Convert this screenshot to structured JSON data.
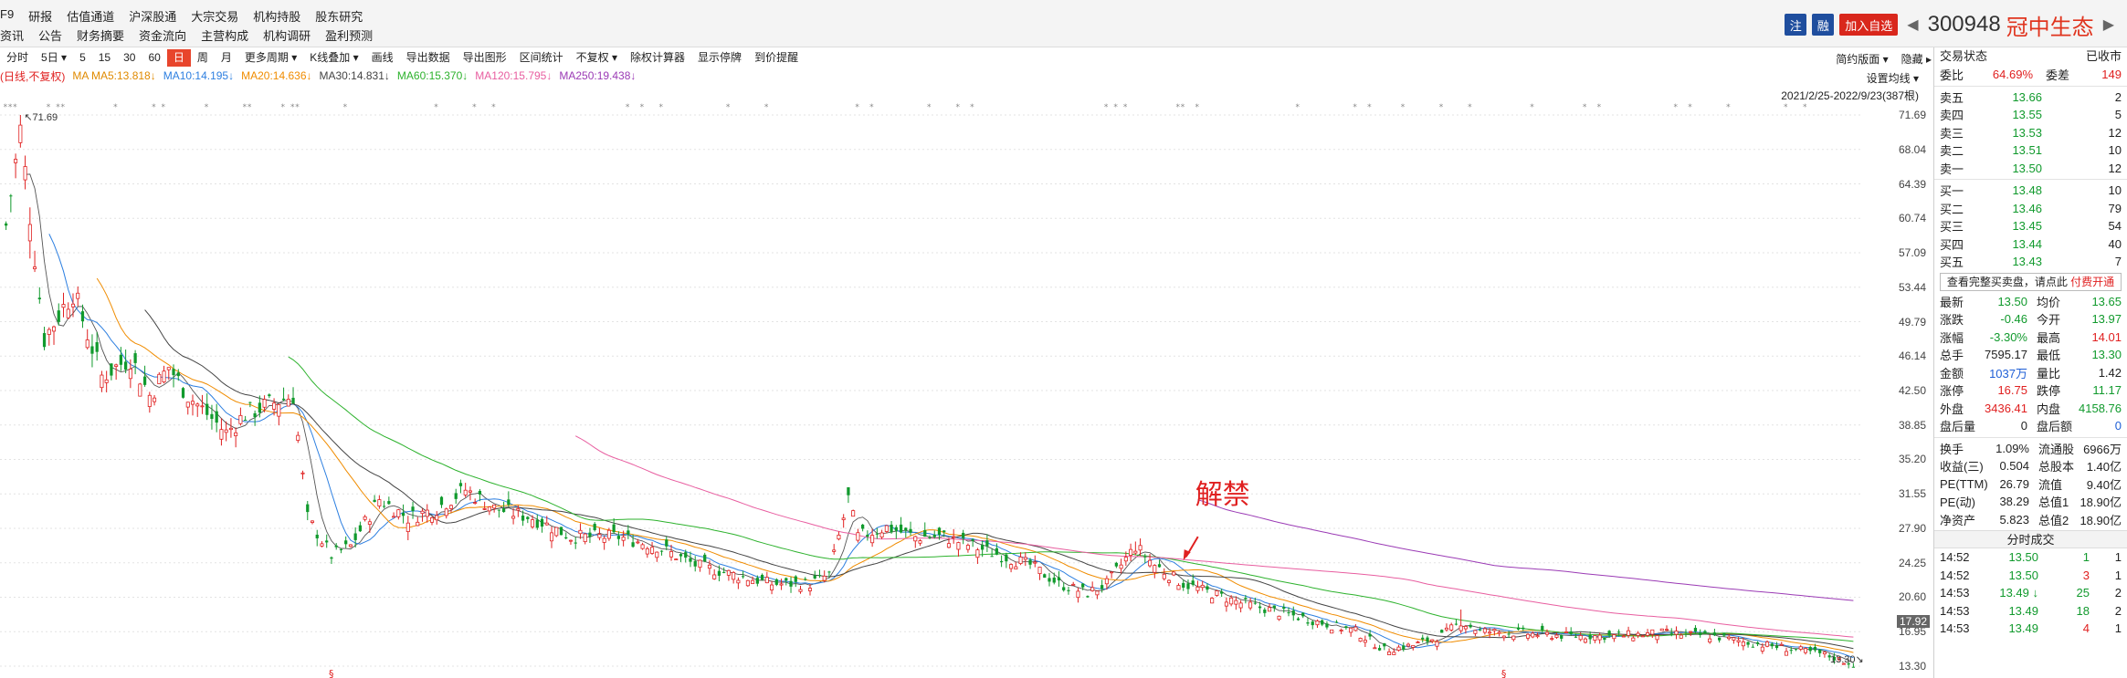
{
  "menu": {
    "row1": [
      "F9",
      "研报",
      "估值通道",
      "沪深股通",
      "大宗交易",
      "机构持股",
      "股东研究"
    ],
    "row2": [
      "资讯",
      "公告",
      "财务摘要",
      "资金流向",
      "主营构成",
      "机构调研",
      "盈利预测"
    ]
  },
  "header": {
    "zhu_label": "注",
    "rong_label": "融",
    "add_label": "加入自选",
    "prev_arrow": "◀",
    "next_arrow": "▶",
    "code": "300948",
    "name": "冠中生态"
  },
  "toolbar": {
    "items": [
      "分时",
      "5日 ▾",
      "5",
      "15",
      "30",
      "60",
      "日",
      "周",
      "月",
      "更多周期 ▾",
      "K线叠加 ▾",
      "画线",
      "导出数据",
      "导出图形",
      "区间统计",
      "不复权 ▾",
      "除权计算器",
      "显示停牌",
      "到价提醒"
    ],
    "active_index": 6,
    "right_items": [
      "简约版面 ▾",
      "隐藏 ▸"
    ]
  },
  "indicators": {
    "title": "(日线,不复权)",
    "ma5": "MA  MA5:13.818↓",
    "ma10": "MA10:14.195↓",
    "ma20": "MA20:14.636↓",
    "ma30": "MA30:14.831↓",
    "ma60": "MA60:15.370↓",
    "ma120": "MA120:15.795↓",
    "ma250": "MA250:19.438↓",
    "settings_label": "设置均线 ▾",
    "range_label": "2021/2/25-2022/9/23(387根)"
  },
  "colors": {
    "up": "#e02020",
    "down": "#119a2d",
    "ma5": "#555555",
    "ma10": "#2d7fe0",
    "ma20": "#f08c00",
    "ma30": "#444444",
    "ma60": "#2db22d",
    "ma120": "#e85ea0",
    "ma250": "#9b3bb5",
    "annotation": "#e02020"
  },
  "chart_data": {
    "type": "candlestick",
    "period": "2021/2/25-2022/9/23",
    "bar_count": 387,
    "y_ticks": [
      "71.69",
      "68.04",
      "64.39",
      "60.74",
      "57.09",
      "53.44",
      "49.79",
      "46.14",
      "42.50",
      "38.85",
      "35.20",
      "31.55",
      "27.90",
      "24.25",
      "20.60",
      "16.95",
      "13.30"
    ],
    "ylim": [
      13.3,
      71.69
    ],
    "max_label": "71.69",
    "min_label": "13.30",
    "current_price_label": "17.92",
    "annotation_text": "解禁",
    "ex_right_marker": "§",
    "close_anchors": [
      [
        0,
        60
      ],
      [
        3,
        70
      ],
      [
        8,
        48
      ],
      [
        14,
        53
      ],
      [
        20,
        44
      ],
      [
        26,
        46
      ],
      [
        30,
        42
      ],
      [
        34,
        45
      ],
      [
        38,
        42
      ],
      [
        42,
        40
      ],
      [
        46,
        38
      ],
      [
        50,
        40
      ],
      [
        55,
        41
      ],
      [
        60,
        42
      ],
      [
        63,
        29
      ],
      [
        68,
        25
      ],
      [
        72,
        26
      ],
      [
        78,
        31
      ],
      [
        84,
        29
      ],
      [
        90,
        30
      ],
      [
        96,
        32
      ],
      [
        102,
        30
      ],
      [
        110,
        29
      ],
      [
        118,
        27
      ],
      [
        128,
        27
      ],
      [
        136,
        26
      ],
      [
        144,
        24
      ],
      [
        152,
        23
      ],
      [
        160,
        22
      ],
      [
        168,
        22
      ],
      [
        172,
        23
      ],
      [
        176,
        31
      ],
      [
        178,
        27
      ],
      [
        184,
        28
      ],
      [
        190,
        27
      ],
      [
        196,
        27
      ],
      [
        202,
        26
      ],
      [
        208,
        25
      ],
      [
        214,
        24
      ],
      [
        220,
        22
      ],
      [
        226,
        21
      ],
      [
        230,
        22
      ],
      [
        236,
        26
      ],
      [
        240,
        24
      ],
      [
        246,
        22
      ],
      [
        252,
        21
      ],
      [
        258,
        20
      ],
      [
        266,
        19
      ],
      [
        274,
        18
      ],
      [
        282,
        17
      ],
      [
        288,
        15
      ],
      [
        294,
        15.5
      ],
      [
        300,
        16.5
      ],
      [
        304,
        18
      ],
      [
        308,
        17
      ],
      [
        316,
        16.8
      ],
      [
        326,
        16.5
      ],
      [
        336,
        16.5
      ],
      [
        346,
        16.8
      ],
      [
        356,
        16.5
      ],
      [
        364,
        15.8
      ],
      [
        372,
        15.2
      ],
      [
        380,
        14.5
      ],
      [
        386,
        13.5
      ]
    ],
    "ma120_start_bar": 120,
    "ma250_start_bar": 250
  },
  "right_panel": {
    "head_left": "交易状态",
    "head_right": "已收市",
    "weibi_label": "委比",
    "weibi_value": "64.69%",
    "weicha_label": "委差",
    "weicha_value": "149",
    "asks": [
      {
        "label": "卖五",
        "price": "13.66",
        "vol": "2"
      },
      {
        "label": "卖四",
        "price": "13.55",
        "vol": "5"
      },
      {
        "label": "卖三",
        "price": "13.53",
        "vol": "12"
      },
      {
        "label": "卖二",
        "price": "13.51",
        "vol": "10"
      },
      {
        "label": "卖一",
        "price": "13.50",
        "vol": "12"
      }
    ],
    "bids": [
      {
        "label": "买一",
        "price": "13.48",
        "vol": "10"
      },
      {
        "label": "买二",
        "price": "13.46",
        "vol": "79"
      },
      {
        "label": "买三",
        "price": "13.45",
        "vol": "54"
      },
      {
        "label": "买四",
        "price": "13.44",
        "vol": "40"
      },
      {
        "label": "买五",
        "price": "13.43",
        "vol": "7"
      }
    ],
    "notice_text": "查看完整买卖盘，请点此",
    "notice_link": "付费开通",
    "quotes": [
      {
        "k1": "最新",
        "v1": "13.50",
        "c1": "green",
        "k2": "均价",
        "v2": "13.65",
        "c2": "green"
      },
      {
        "k1": "涨跌",
        "v1": "-0.46",
        "c1": "green",
        "k2": "今开",
        "v2": "13.97",
        "c2": "green"
      },
      {
        "k1": "涨幅",
        "v1": "-3.30%",
        "c1": "green",
        "k2": "最高",
        "v2": "14.01",
        "c2": "red"
      },
      {
        "k1": "总手",
        "v1": "7595.17",
        "c1": "",
        "k2": "最低",
        "v2": "13.30",
        "c2": "green"
      },
      {
        "k1": "金额",
        "v1": "1037万",
        "c1": "blue",
        "k2": "量比",
        "v2": "1.42",
        "c2": ""
      },
      {
        "k1": "涨停",
        "v1": "16.75",
        "c1": "red",
        "k2": "跌停",
        "v2": "11.17",
        "c2": "green"
      },
      {
        "k1": "外盘",
        "v1": "3436.41",
        "c1": "red",
        "k2": "内盘",
        "v2": "4158.76",
        "c2": "green"
      },
      {
        "k1": "盘后量",
        "v1": "0",
        "c1": "",
        "k2": "盘后额",
        "v2": "0",
        "c2": "blue"
      }
    ],
    "fundamentals": [
      {
        "k1": "换手",
        "v1": "1.09%",
        "k2": "流通股",
        "v2": "6966万"
      },
      {
        "k1": "收益(三)",
        "v1": "0.504",
        "k2": "总股本",
        "v2": "1.40亿"
      },
      {
        "k1": "PE(TTM)",
        "v1": "26.79",
        "k2": "流值",
        "v2": "9.40亿"
      },
      {
        "k1": "PE(动)",
        "v1": "38.29",
        "k2": "总值1",
        "v2": "18.90亿"
      },
      {
        "k1": "净资产",
        "v1": "5.823",
        "k2": "总值2",
        "v2": "18.90亿"
      }
    ],
    "trades_title": "分时成交",
    "trades": [
      {
        "t": "14:52",
        "p": "13.50",
        "pc": "green",
        "v": "1",
        "vc": "green",
        "n": "1"
      },
      {
        "t": "14:52",
        "p": "13.50",
        "pc": "green",
        "v": "3",
        "vc": "red",
        "n": "1"
      },
      {
        "t": "14:53",
        "p": "13.49 ↓",
        "pc": "green",
        "v": "25",
        "vc": "green",
        "n": "2"
      },
      {
        "t": "14:53",
        "p": "13.49",
        "pc": "green",
        "v": "18",
        "vc": "green",
        "n": "2"
      },
      {
        "t": "14:53",
        "p": "13.49",
        "pc": "green",
        "v": "4",
        "vc": "red",
        "n": "1"
      }
    ]
  }
}
